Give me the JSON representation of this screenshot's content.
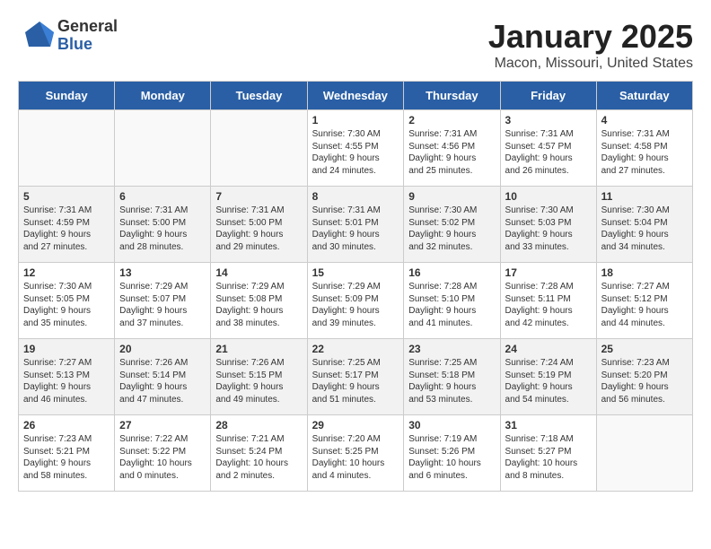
{
  "header": {
    "logo_general": "General",
    "logo_blue": "Blue",
    "month_title": "January 2025",
    "location": "Macon, Missouri, United States"
  },
  "weekdays": [
    "Sunday",
    "Monday",
    "Tuesday",
    "Wednesday",
    "Thursday",
    "Friday",
    "Saturday"
  ],
  "weeks": [
    [
      {
        "day": "",
        "info": ""
      },
      {
        "day": "",
        "info": ""
      },
      {
        "day": "",
        "info": ""
      },
      {
        "day": "1",
        "info": "Sunrise: 7:30 AM\nSunset: 4:55 PM\nDaylight: 9 hours\nand 24 minutes."
      },
      {
        "day": "2",
        "info": "Sunrise: 7:31 AM\nSunset: 4:56 PM\nDaylight: 9 hours\nand 25 minutes."
      },
      {
        "day": "3",
        "info": "Sunrise: 7:31 AM\nSunset: 4:57 PM\nDaylight: 9 hours\nand 26 minutes."
      },
      {
        "day": "4",
        "info": "Sunrise: 7:31 AM\nSunset: 4:58 PM\nDaylight: 9 hours\nand 27 minutes."
      }
    ],
    [
      {
        "day": "5",
        "info": "Sunrise: 7:31 AM\nSunset: 4:59 PM\nDaylight: 9 hours\nand 27 minutes."
      },
      {
        "day": "6",
        "info": "Sunrise: 7:31 AM\nSunset: 5:00 PM\nDaylight: 9 hours\nand 28 minutes."
      },
      {
        "day": "7",
        "info": "Sunrise: 7:31 AM\nSunset: 5:00 PM\nDaylight: 9 hours\nand 29 minutes."
      },
      {
        "day": "8",
        "info": "Sunrise: 7:31 AM\nSunset: 5:01 PM\nDaylight: 9 hours\nand 30 minutes."
      },
      {
        "day": "9",
        "info": "Sunrise: 7:30 AM\nSunset: 5:02 PM\nDaylight: 9 hours\nand 32 minutes."
      },
      {
        "day": "10",
        "info": "Sunrise: 7:30 AM\nSunset: 5:03 PM\nDaylight: 9 hours\nand 33 minutes."
      },
      {
        "day": "11",
        "info": "Sunrise: 7:30 AM\nSunset: 5:04 PM\nDaylight: 9 hours\nand 34 minutes."
      }
    ],
    [
      {
        "day": "12",
        "info": "Sunrise: 7:30 AM\nSunset: 5:05 PM\nDaylight: 9 hours\nand 35 minutes."
      },
      {
        "day": "13",
        "info": "Sunrise: 7:29 AM\nSunset: 5:07 PM\nDaylight: 9 hours\nand 37 minutes."
      },
      {
        "day": "14",
        "info": "Sunrise: 7:29 AM\nSunset: 5:08 PM\nDaylight: 9 hours\nand 38 minutes."
      },
      {
        "day": "15",
        "info": "Sunrise: 7:29 AM\nSunset: 5:09 PM\nDaylight: 9 hours\nand 39 minutes."
      },
      {
        "day": "16",
        "info": "Sunrise: 7:28 AM\nSunset: 5:10 PM\nDaylight: 9 hours\nand 41 minutes."
      },
      {
        "day": "17",
        "info": "Sunrise: 7:28 AM\nSunset: 5:11 PM\nDaylight: 9 hours\nand 42 minutes."
      },
      {
        "day": "18",
        "info": "Sunrise: 7:27 AM\nSunset: 5:12 PM\nDaylight: 9 hours\nand 44 minutes."
      }
    ],
    [
      {
        "day": "19",
        "info": "Sunrise: 7:27 AM\nSunset: 5:13 PM\nDaylight: 9 hours\nand 46 minutes."
      },
      {
        "day": "20",
        "info": "Sunrise: 7:26 AM\nSunset: 5:14 PM\nDaylight: 9 hours\nand 47 minutes."
      },
      {
        "day": "21",
        "info": "Sunrise: 7:26 AM\nSunset: 5:15 PM\nDaylight: 9 hours\nand 49 minutes."
      },
      {
        "day": "22",
        "info": "Sunrise: 7:25 AM\nSunset: 5:17 PM\nDaylight: 9 hours\nand 51 minutes."
      },
      {
        "day": "23",
        "info": "Sunrise: 7:25 AM\nSunset: 5:18 PM\nDaylight: 9 hours\nand 53 minutes."
      },
      {
        "day": "24",
        "info": "Sunrise: 7:24 AM\nSunset: 5:19 PM\nDaylight: 9 hours\nand 54 minutes."
      },
      {
        "day": "25",
        "info": "Sunrise: 7:23 AM\nSunset: 5:20 PM\nDaylight: 9 hours\nand 56 minutes."
      }
    ],
    [
      {
        "day": "26",
        "info": "Sunrise: 7:23 AM\nSunset: 5:21 PM\nDaylight: 9 hours\nand 58 minutes."
      },
      {
        "day": "27",
        "info": "Sunrise: 7:22 AM\nSunset: 5:22 PM\nDaylight: 10 hours\nand 0 minutes."
      },
      {
        "day": "28",
        "info": "Sunrise: 7:21 AM\nSunset: 5:24 PM\nDaylight: 10 hours\nand 2 minutes."
      },
      {
        "day": "29",
        "info": "Sunrise: 7:20 AM\nSunset: 5:25 PM\nDaylight: 10 hours\nand 4 minutes."
      },
      {
        "day": "30",
        "info": "Sunrise: 7:19 AM\nSunset: 5:26 PM\nDaylight: 10 hours\nand 6 minutes."
      },
      {
        "day": "31",
        "info": "Sunrise: 7:18 AM\nSunset: 5:27 PM\nDaylight: 10 hours\nand 8 minutes."
      },
      {
        "day": "",
        "info": ""
      }
    ]
  ]
}
